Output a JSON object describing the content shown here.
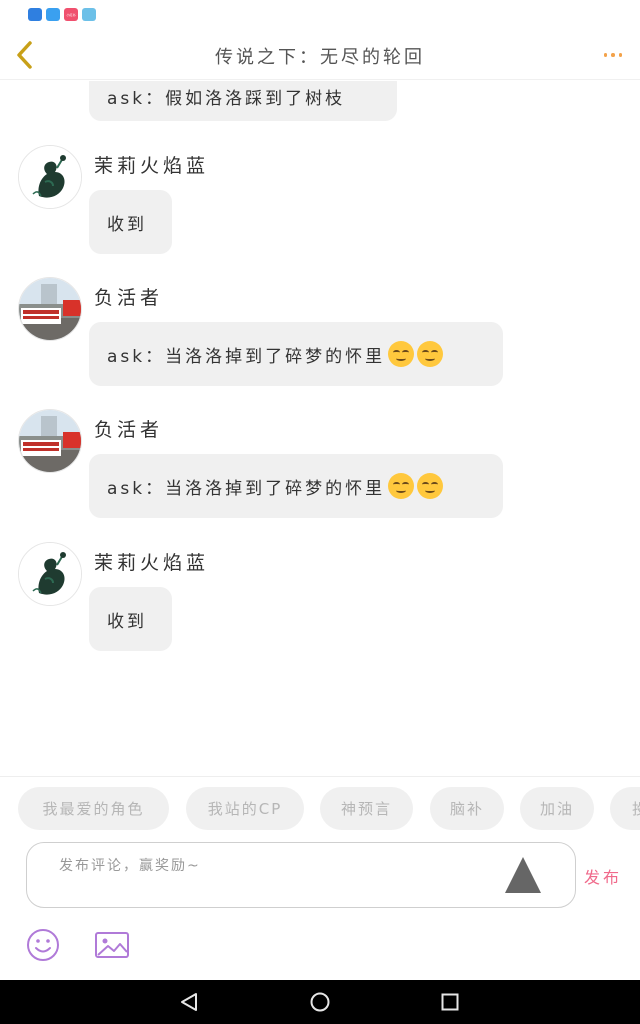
{
  "status_bar": {
    "icons": [
      {
        "name": "shield-app-icon",
        "color": "#2f7fe0"
      },
      {
        "name": "chat-app-icon",
        "color": "#3aa0f0"
      },
      {
        "name": "news-app-icon",
        "color": "#f0506e",
        "text": "小红书"
      },
      {
        "name": "map-app-icon",
        "color": "#6cc0e8"
      }
    ]
  },
  "header": {
    "title": "传说之下：无尽的轮回",
    "back_icon": "chevron-left-icon",
    "more_icon": "more-dots-icon",
    "accent": "#f3a24a"
  },
  "comments": [
    {
      "user": "",
      "text": "ask：假如洛洛踩到了树枝",
      "emojis": 0,
      "partial": true
    },
    {
      "user": "茉莉火焰蓝",
      "text": "收到",
      "emojis": 0,
      "avatar": "dark-plant-avatar"
    },
    {
      "user": "负活者",
      "text": "ask：当洛洛掉到了碎梦的怀里",
      "emojis": 2,
      "avatar": "street-photo-avatar"
    },
    {
      "user": "负活者",
      "text": "ask：当洛洛掉到了碎梦的怀里",
      "emojis": 2,
      "avatar": "street-photo-avatar"
    },
    {
      "user": "茉莉火焰蓝",
      "text": "收到",
      "emojis": 0,
      "avatar": "dark-plant-avatar"
    }
  ],
  "tags": [
    "我最爱的角色",
    "我站的CP",
    "神预言",
    "脑补",
    "加油",
    "投"
  ],
  "composer": {
    "placeholder": "发布评论，赢奖励~",
    "publish_label": "发布",
    "publish_color": "#f06a8b",
    "emoji_icon": "smiley-icon",
    "image_icon": "image-icon",
    "icon_color": "#b07ad8"
  },
  "nav_bar": {
    "back_icon": "nav-back-icon",
    "home_icon": "nav-home-icon",
    "recent_icon": "nav-recent-icon"
  }
}
